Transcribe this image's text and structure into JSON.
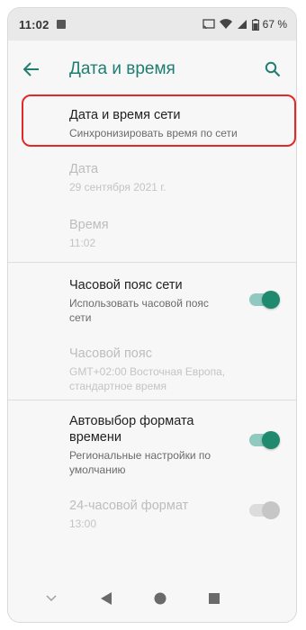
{
  "status": {
    "time": "11:02",
    "battery": "67 %"
  },
  "appbar": {
    "title": "Дата и время"
  },
  "settings": [
    {
      "title": "Дата и время сети",
      "summary": "Синхронизировать время по сети"
    },
    {
      "title": "Дата",
      "summary": "29 сентября 2021 г."
    },
    {
      "title": "Время",
      "summary": "11:02"
    },
    {
      "title": "Часовой пояс сети",
      "summary": "Использовать часовой пояс сети"
    },
    {
      "title": "Часовой пояс",
      "summary": "GMT+02:00 Восточная Европа, стандартное время"
    },
    {
      "title": "Автовыбор формата времени",
      "summary": "Региональные настройки по умолчанию"
    },
    {
      "title": "24-часовой формат",
      "summary": "13:00"
    }
  ],
  "colors": {
    "accent": "#1f7d71",
    "highlight": "#e02a2a"
  }
}
